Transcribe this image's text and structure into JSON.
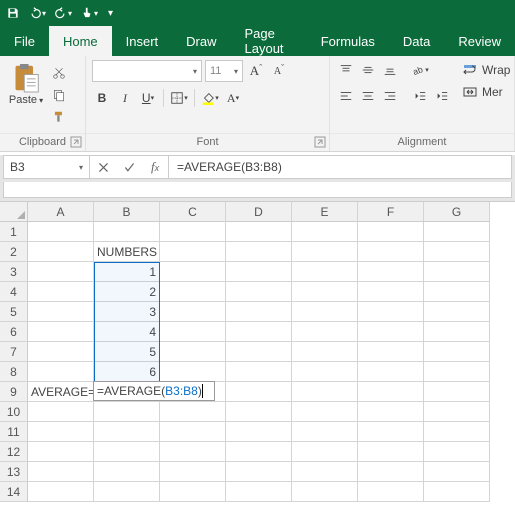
{
  "qat": {
    "save": "save",
    "undo": "undo",
    "redo": "redo",
    "touch": "touch"
  },
  "tabs": [
    "File",
    "Home",
    "Insert",
    "Draw",
    "Page Layout",
    "Formulas",
    "Data",
    "Review"
  ],
  "active_tab": 1,
  "ribbon": {
    "clipboard": {
      "paste": "Paste",
      "label": "Clipboard"
    },
    "font": {
      "name_placeholder": "",
      "size_placeholder": "11",
      "label": "Font"
    },
    "alignment": {
      "label": "Alignment",
      "wrap": "Wrap",
      "merge": "Mer"
    }
  },
  "namebox": "B3",
  "formula": "=AVERAGE(B3:B8)",
  "columns": [
    "A",
    "B",
    "C",
    "D",
    "E",
    "F",
    "G"
  ],
  "rows": [
    "1",
    "2",
    "3",
    "4",
    "5",
    "6",
    "7",
    "8",
    "9",
    "10",
    "11",
    "12",
    "13",
    "14"
  ],
  "cells": {
    "B2": "NUMBERS",
    "B3": "1",
    "B4": "2",
    "B5": "3",
    "B6": "4",
    "B7": "5",
    "B8": "6",
    "A9": "AVERAGE=",
    "B9_prefix": "=AVERAGE(",
    "B9_ref": "B3:B8",
    "B9_suffix": ")"
  },
  "chart_data": {
    "type": "table",
    "title": "NUMBERS",
    "categories": [
      "B3",
      "B4",
      "B5",
      "B6",
      "B7",
      "B8"
    ],
    "values": [
      1,
      2,
      3,
      4,
      5,
      6
    ],
    "formula": "=AVERAGE(B3:B8)"
  }
}
